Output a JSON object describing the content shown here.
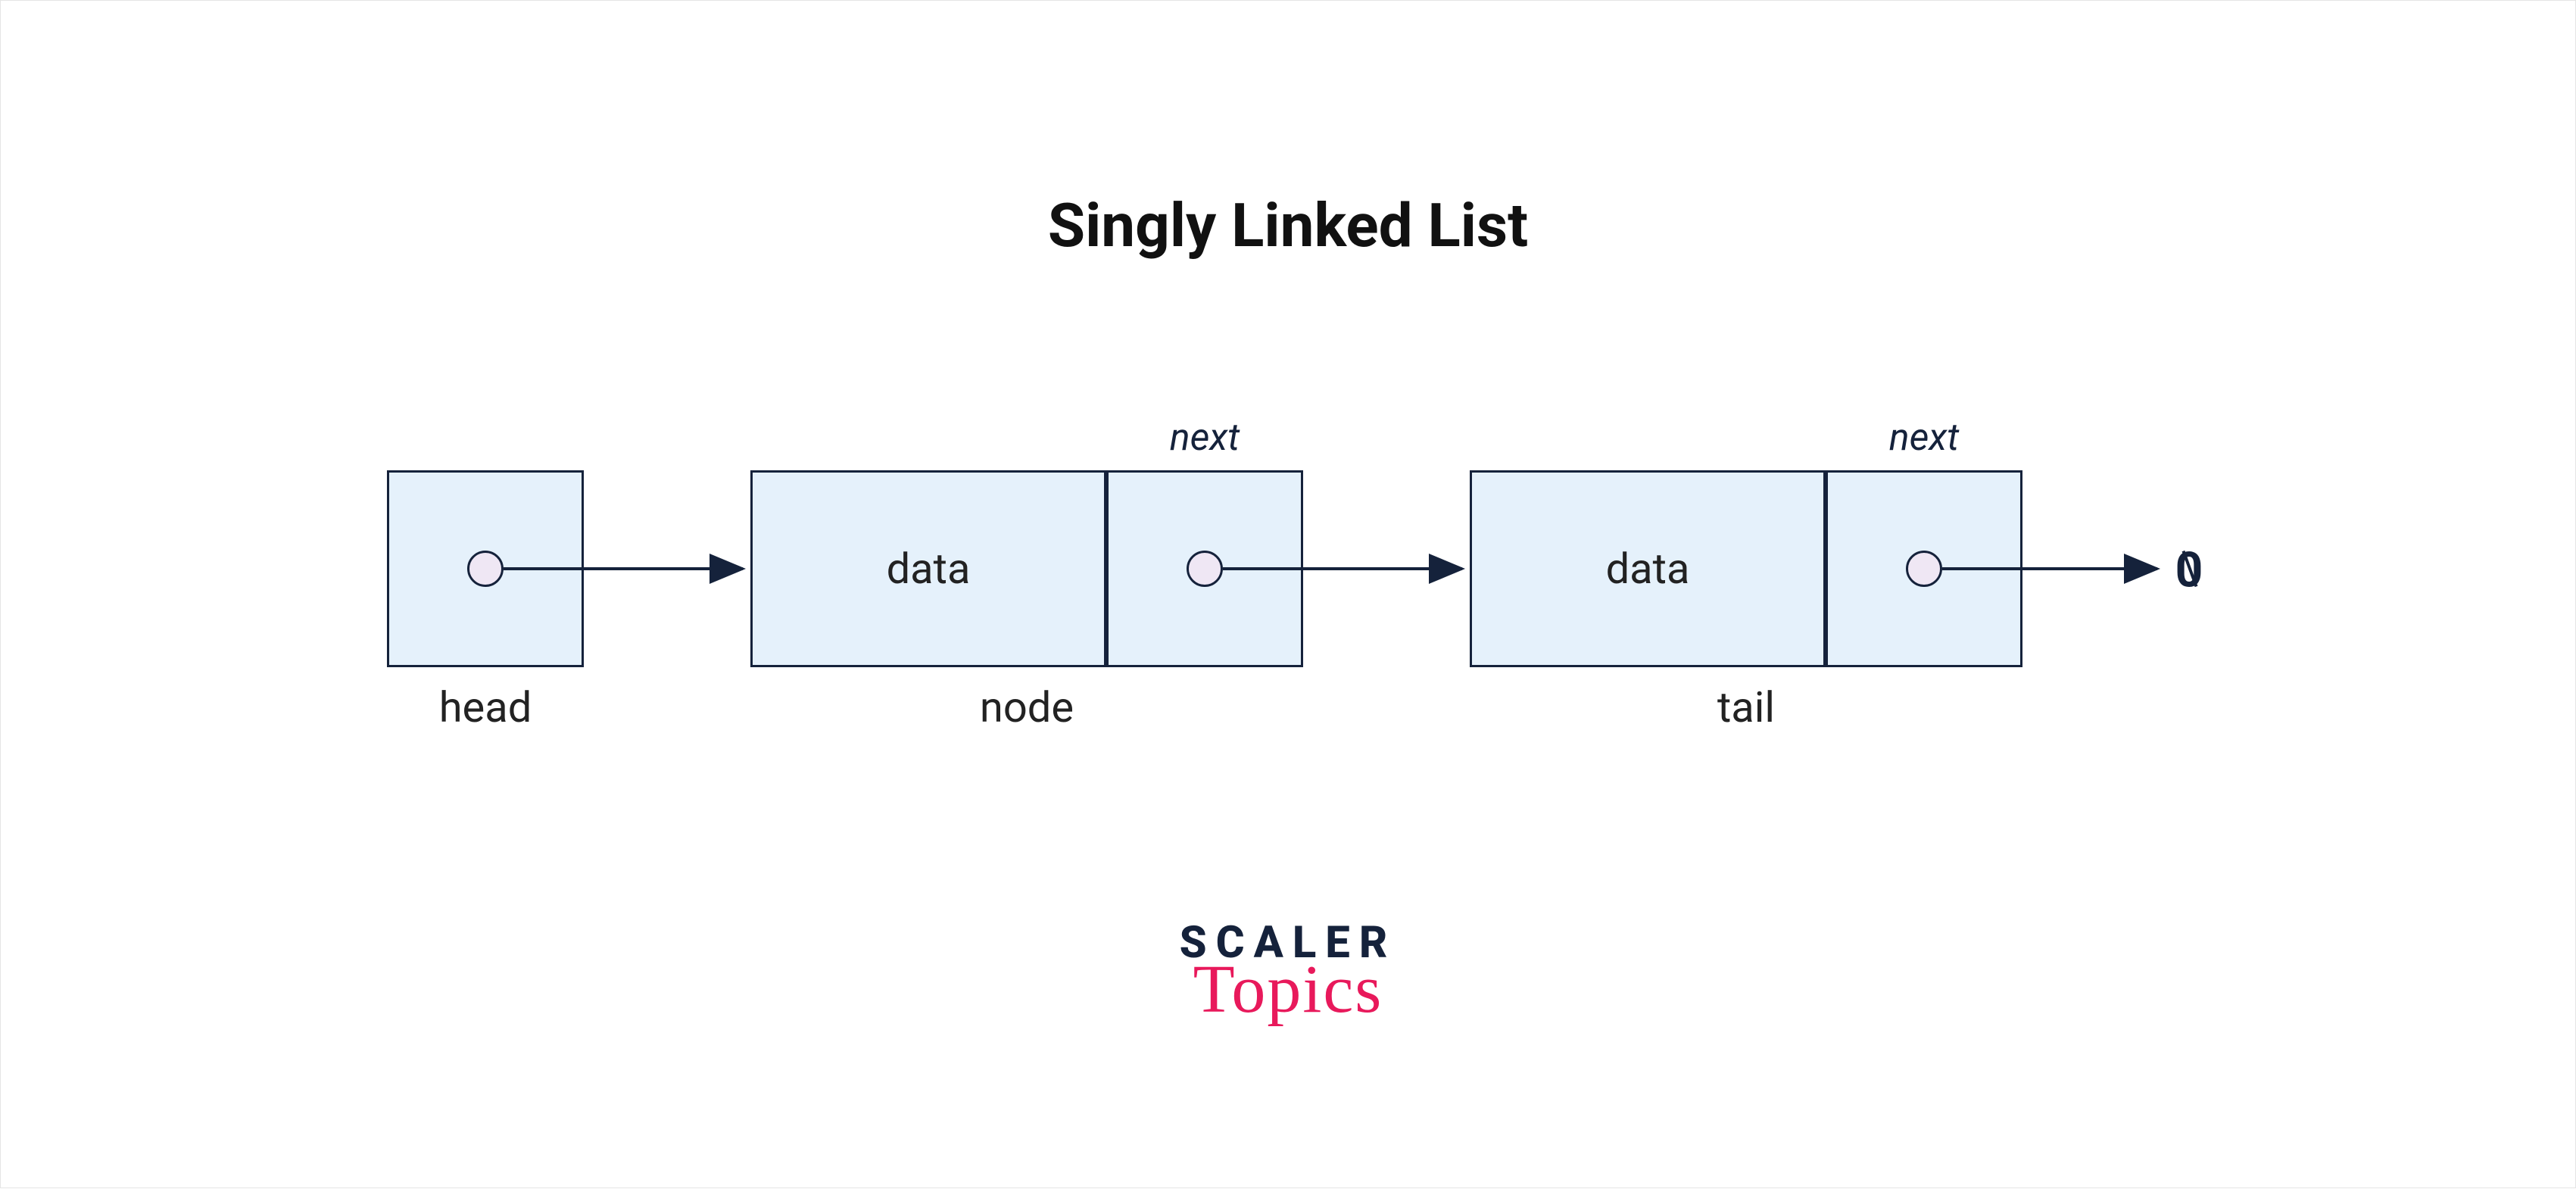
{
  "title": "Singly Linked List",
  "head": {
    "label": "head"
  },
  "node1": {
    "data_label": "data",
    "next_label": "next",
    "below_label": "node"
  },
  "node2": {
    "data_label": "data",
    "next_label": "next",
    "below_label": "tail"
  },
  "null_symbol": "0",
  "logo": {
    "line1": "SCALER",
    "line2": "Topics"
  },
  "colors": {
    "box_fill": "#e5f1fb",
    "box_stroke": "#15223b",
    "dot_fill": "#efe7f4",
    "accent": "#e8195b"
  }
}
